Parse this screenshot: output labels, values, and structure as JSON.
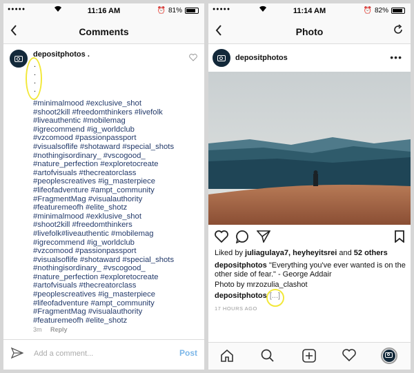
{
  "left": {
    "status": {
      "carrier": "●●●●●",
      "time": "11:16 AM",
      "battery": "81%",
      "battery_level": 0.81
    },
    "nav": {
      "back": "‹",
      "title": "Comments"
    },
    "comment": {
      "username": "depositphotos .",
      "dots": ".\n.\n.\n.",
      "hashtags": [
        "#minimalmood #exclusive_shot",
        "#shoot2kill #freedomthinkers #livefolk",
        "#liveauthentic #mobilemag",
        "#igrecommend #ig_worldclub",
        "#vzcomood #passionpassport",
        "#visualsoflife #shotaward #special_shots",
        "#nothingisordinary_ #vscogood_",
        "#nature_perfection #exploretocreate",
        "#artofvisuals #thecreatorclass",
        "#peoplescreatives #ig_masterpiece",
        "#lifeofadventure #ampt_community",
        "#FragmentMag #visualauthority",
        "#featuremeofh #elite_shotz",
        "#minimalmood #exklusive_shot",
        "#shoot2kill #freedomthinkers",
        "#livefolk#liveauthentic #mobilemag",
        "#igrecommend #ig_worldclub",
        "#vzcomood #passionpassport",
        "#visualsoflife #shotaward #special_shots",
        "#nothingisordinary_ #vscogood_",
        "#nature_perfection #exploretocreate",
        "#artofvisuals #thecreatorclass",
        "#peoplescreatives #ig_masterpiece",
        "#lifeofadventure #ampt_community",
        "#FragmentMag #visualauthority",
        "#featuremeofh #elite_shotz"
      ],
      "time": "3m",
      "reply": "Reply"
    },
    "input": {
      "placeholder": "Add a comment...",
      "post": "Post"
    }
  },
  "right": {
    "status": {
      "carrier": "●●●●●",
      "time": "11:14 AM",
      "battery": "82%",
      "battery_level": 0.82
    },
    "nav": {
      "back": "‹",
      "title": "Photo"
    },
    "post": {
      "username": "depositphotos",
      "likes_prefix": "Liked by ",
      "likes_users": "juliagulaya7, heyheyitsrei",
      "likes_mid": " and ",
      "likes_count": "52 others",
      "caption_user": "depositphotos",
      "caption_text": " \"Everything you've ever wanted is on the other side of fear.\" - George Addair",
      "credit": "Photo by mrzozulia_clashot",
      "caption2_user": "depositphotos",
      "caption2_more": "[...]",
      "ago": "17 HOURS AGO"
    }
  },
  "colors": {
    "hashtag": "#233a6a",
    "post_button": "#7bb6e8",
    "highlight": "#f2e83a"
  }
}
